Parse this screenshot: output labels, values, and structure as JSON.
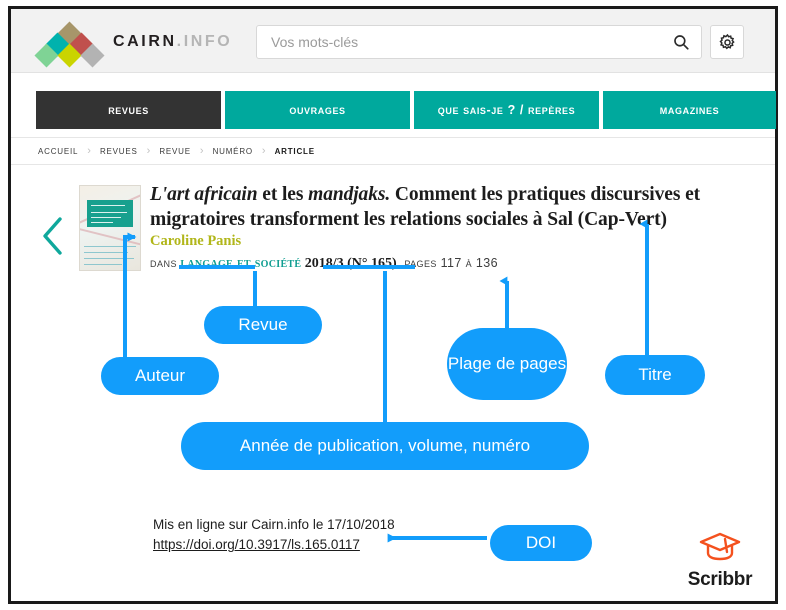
{
  "site": {
    "logo_text": "CAIRN",
    "logo_suffix": ".INFO",
    "logo_icon": "cairn-diamonds-logo"
  },
  "search": {
    "placeholder": "Vos mots-clés",
    "value": "",
    "search_icon": "search-icon",
    "settings_icon": "gear-icon"
  },
  "tabs": [
    {
      "label": "Revues",
      "active": true
    },
    {
      "label": "Ouvrages",
      "active": false
    },
    {
      "label": "Que sais-je ? / Repères",
      "active": false
    },
    {
      "label": "Magazines",
      "active": false
    }
  ],
  "breadcrumb": {
    "separator": "›",
    "items": [
      "Accueil",
      "Revues",
      "Revue",
      "Numéro",
      "Article"
    ]
  },
  "article": {
    "title_part_1": "L'art africain",
    "title_part_2": " et les ",
    "title_part_3": "mandjaks.",
    "title_part_4": " Comment les pratiques discursives et migratoires transforment les relations sociales à Sal (Cap-Vert)",
    "author": "Caroline Panis",
    "dans_label": "Dans",
    "journal": "Langage et société",
    "issue": "2018/3 (N° 165)",
    "pages": ", pages 117 à 136",
    "online_notice": "Mis en ligne sur Cairn.info le 17/10/2018",
    "doi_url": "https://doi.org/10.3917/ls.165.0117",
    "prev_icon": "chevron-left-icon",
    "cover_alt": "journal-cover-thumbnail"
  },
  "annotations": {
    "auteur": "Auteur",
    "revue": "Revue",
    "plage_de_pages": "Plage de pages",
    "titre": "Titre",
    "annee": "Année de publication, volume, numéro",
    "doi": "DOI",
    "accent_color": "#129dfb"
  },
  "watermark": {
    "brand": "Scribbr",
    "icon": "graduation-cap-icon",
    "color": "#f4511e"
  },
  "colors": {
    "teal": "#00a99d",
    "active_tab": "#333333",
    "author_olive": "#b1b61a",
    "journal_teal": "#0f9e91",
    "annotation_blue": "#129dfb"
  }
}
